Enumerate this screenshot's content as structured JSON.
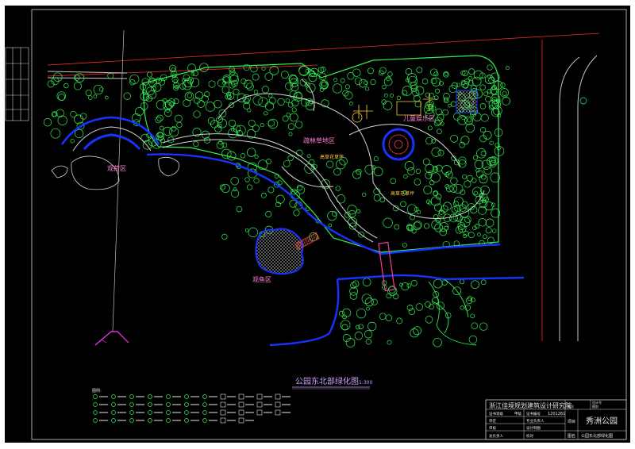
{
  "drawing": {
    "title": "公园东北部绿化图",
    "scale": "1:300",
    "legend_heading": "图例:"
  },
  "zones": {
    "lotus": "观荷区",
    "lawn": "疏林草地区",
    "kids": "儿童娱乐区",
    "fish": "观鱼区",
    "flower1": "高草花草坪",
    "flower2": "高草花草坪"
  },
  "title_block": {
    "company": "浙江佳境规划建筑设计研究院",
    "cert_label": "证书等级",
    "cert_grade": "甲级",
    "cert_no_label": "证书编号",
    "cert_no": "1201261",
    "project_name": "秀洲公园",
    "drawing_name": "公园东北部绿化图",
    "row_labels": [
      "审定",
      "审核",
      "总负责人"
    ],
    "mid_labels": [
      "专业负责人",
      "设计制图",
      "校对"
    ],
    "right_labels": [
      "项目",
      "图名"
    ],
    "top_right": [
      "设计号",
      "图别",
      "图号"
    ]
  },
  "colors": {
    "bg": "#000000",
    "paper": "#ffffff",
    "tree": "#33ee55",
    "path": "#d8d8d8",
    "water": "#1733ff",
    "redline": "#ff2a2a",
    "label": "#ff7fd5",
    "title": "#c9a3ff"
  }
}
